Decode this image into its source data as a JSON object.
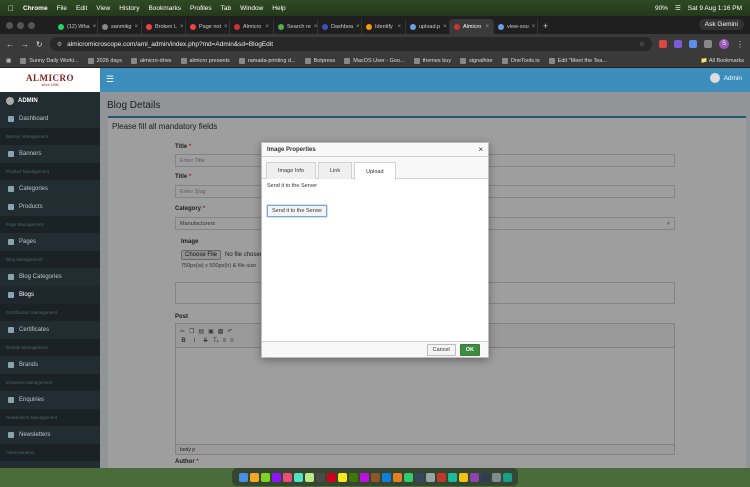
{
  "mac_menubar": {
    "app": "Chrome",
    "items": [
      "File",
      "Edit",
      "View",
      "History",
      "Bookmarks",
      "Profiles",
      "Tab",
      "Window",
      "Help"
    ],
    "battery": "90%",
    "datetime": "Sat 9 Aug 1:16 PM"
  },
  "browser": {
    "tabs": [
      {
        "label": "(12) Wha"
      },
      {
        "label": "sanmikg"
      },
      {
        "label": "Broken L"
      },
      {
        "label": "Page not"
      },
      {
        "label": "Almicro"
      },
      {
        "label": "Search re"
      },
      {
        "label": "Dashboa"
      },
      {
        "label": "Identify"
      },
      {
        "label": "upload.p"
      },
      {
        "label": "Almicro"
      },
      {
        "label": "view-sou"
      }
    ],
    "active_tab_index": 9,
    "ask_gemini": "Ask Gemini",
    "url": "almicromicroscope.com/aml_admin/index.php?md=Admin&sd=BlogEdit",
    "bookmarks": [
      "Sunny Daily Worki...",
      "2026 days",
      "almicro-drive",
      "almicro presents",
      "ramada-printing d...",
      "Botpress",
      "MacOS User - Goo...",
      "themes buy",
      "signalhire",
      "OneTools.io",
      "Edit \"Meet the Tea..."
    ],
    "all_bookmarks": "All Bookmarks"
  },
  "app": {
    "logo": "ALMICRO",
    "logo_sub": "since 1998",
    "admin_top": "Admin",
    "sidebar": {
      "user": "ADMIN",
      "entries": [
        {
          "type": "item",
          "label": "Dashboard"
        },
        {
          "type": "header",
          "label": "Banner Management"
        },
        {
          "type": "item",
          "label": "Banners"
        },
        {
          "type": "header",
          "label": "Product Management"
        },
        {
          "type": "item",
          "label": "Categories"
        },
        {
          "type": "item",
          "label": "Products"
        },
        {
          "type": "header",
          "label": "Page Management"
        },
        {
          "type": "item",
          "label": "Pages"
        },
        {
          "type": "header",
          "label": "Blog Management"
        },
        {
          "type": "item",
          "label": "Blog Categories"
        },
        {
          "type": "item",
          "label": "Blogs",
          "active": true
        },
        {
          "type": "header",
          "label": "Certification Management"
        },
        {
          "type": "item",
          "label": "Certificates"
        },
        {
          "type": "header",
          "label": "Brands Management"
        },
        {
          "type": "item",
          "label": "Brands"
        },
        {
          "type": "header",
          "label": "Enquiries Management"
        },
        {
          "type": "item",
          "label": "Enquiries"
        },
        {
          "type": "header",
          "label": "Newsletters Management"
        },
        {
          "type": "item",
          "label": "Newsletters"
        },
        {
          "type": "header",
          "label": "Administration"
        }
      ]
    },
    "page_title": "Blog Details",
    "subtitle": "Please fill all mandatory fields",
    "form": {
      "title1_label": "Title",
      "title1_placeholder": "Enter Title",
      "title2_label": "Title",
      "title2_placeholder": "Enter Slug",
      "category_label": "Category",
      "category_value": "Manufacturers",
      "image_label": "Image",
      "choose_file": "Choose File",
      "no_file": "No file chosen",
      "image_hint": "750px(w) x 500px(h) & file size",
      "post_label": "Post",
      "editor_footer": "body  p",
      "next_label": "Author"
    }
  },
  "dialog": {
    "title": "Image Properties",
    "tabs": [
      "Image Info",
      "Link",
      "Upload"
    ],
    "active_tab": 2,
    "send_label": "Send it to the Server",
    "send_button": "Send it to the Server",
    "cancel": "Cancel",
    "ok": "OK"
  },
  "colors": {
    "topbar": "#3c8dbc",
    "sidebar": "#222d32",
    "ok_button": "#3f8c43",
    "logo": "#8b1a1a"
  }
}
